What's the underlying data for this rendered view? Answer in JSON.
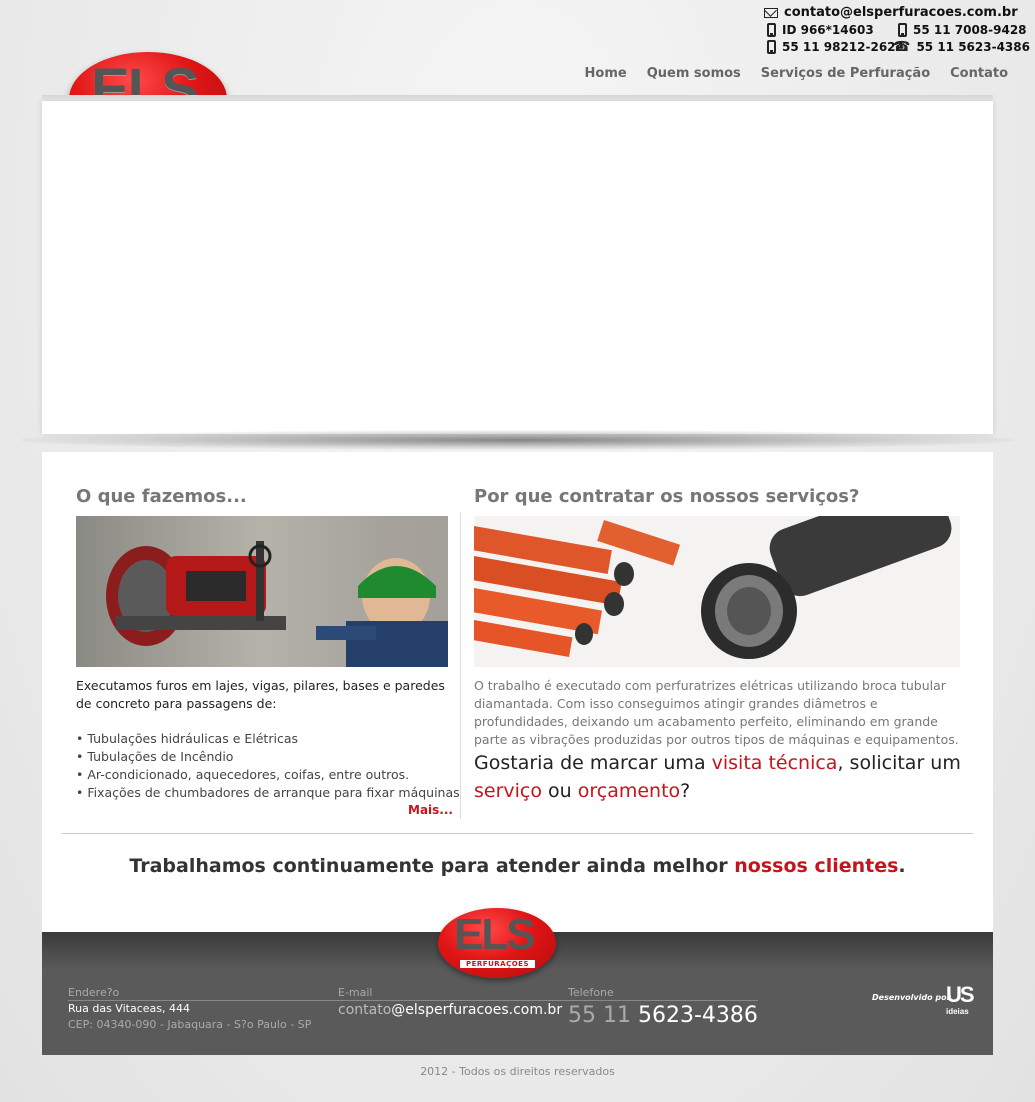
{
  "contacts": {
    "email": "contato@elsperfuracoes.com.br",
    "id": "ID 966*14603",
    "phone1": "55 11 7008-9428",
    "phone2": "55 11 98212-2622",
    "phone3": "55 11 5623-4386"
  },
  "logo": {
    "main": "ELS",
    "sub": "PERFURAÇÕES"
  },
  "nav": [
    {
      "label": "Home"
    },
    {
      "label": "Quem somos"
    },
    {
      "label": "Serviços de Perfuração"
    },
    {
      "label": "Contato"
    }
  ],
  "left": {
    "title": "O que fazemos...",
    "intro": "Executamos furos em lajes, vigas, pilares, bases e paredes de concreto para passagens de:",
    "bullets": [
      "• Tubulações hidráulicas e Elétricas",
      "• Tubulações de Incêndio",
      "• Ar-condicionado, aquecedores, coifas, entre outros.",
      "• Fixações de chumbadores de arranque para fixar máquinas"
    ],
    "more": "Mais..."
  },
  "right": {
    "title": "Por que contratar os nossos serviços?",
    "body": "O trabalho é executado com perfuratrizes elétricas utilizando broca tubular diamantada. Com isso conseguimos atingir grandes diâmetros e profundidades, deixando um acabamento perfeito, eliminando em grande parte as vibrações produzidas por outros tipos de máquinas e equipamentos.",
    "cta_1": "Gostaria de marcar uma ",
    "cta_link1": "visita técnica",
    "cta_2": ", solicitar um ",
    "cta_link2": "serviço",
    "cta_3": " ou ",
    "cta_link3": "orçamento",
    "cta_4": "?"
  },
  "tagline": {
    "text": "Trabalhamos continuamente para atender ainda melhor ",
    "highlight": "nossos clientes",
    "end": "."
  },
  "footer": {
    "address_label": "Endere?o",
    "address_line1": "Rua das Vitaceas, 444",
    "address_line2": "CEP: 04340-090 - Jabaquara - S?o Paulo - SP",
    "email_label": "E-mail",
    "email_pre": "contato",
    "email_post": "@elsperfuracoes.com.br",
    "phone_label": "Telefone",
    "phone_pre": "55 11 ",
    "phone_num": "5623-4386",
    "dev_label": "Desenvolvido por",
    "dev_logo_main": "US",
    "dev_logo_sub": "ideias",
    "copyright": "2012 - Todos os direitos reservados"
  },
  "colors": {
    "accent": "#c4151c",
    "logo_red": "#e11515",
    "footer_bg": "#5a5a5a"
  }
}
